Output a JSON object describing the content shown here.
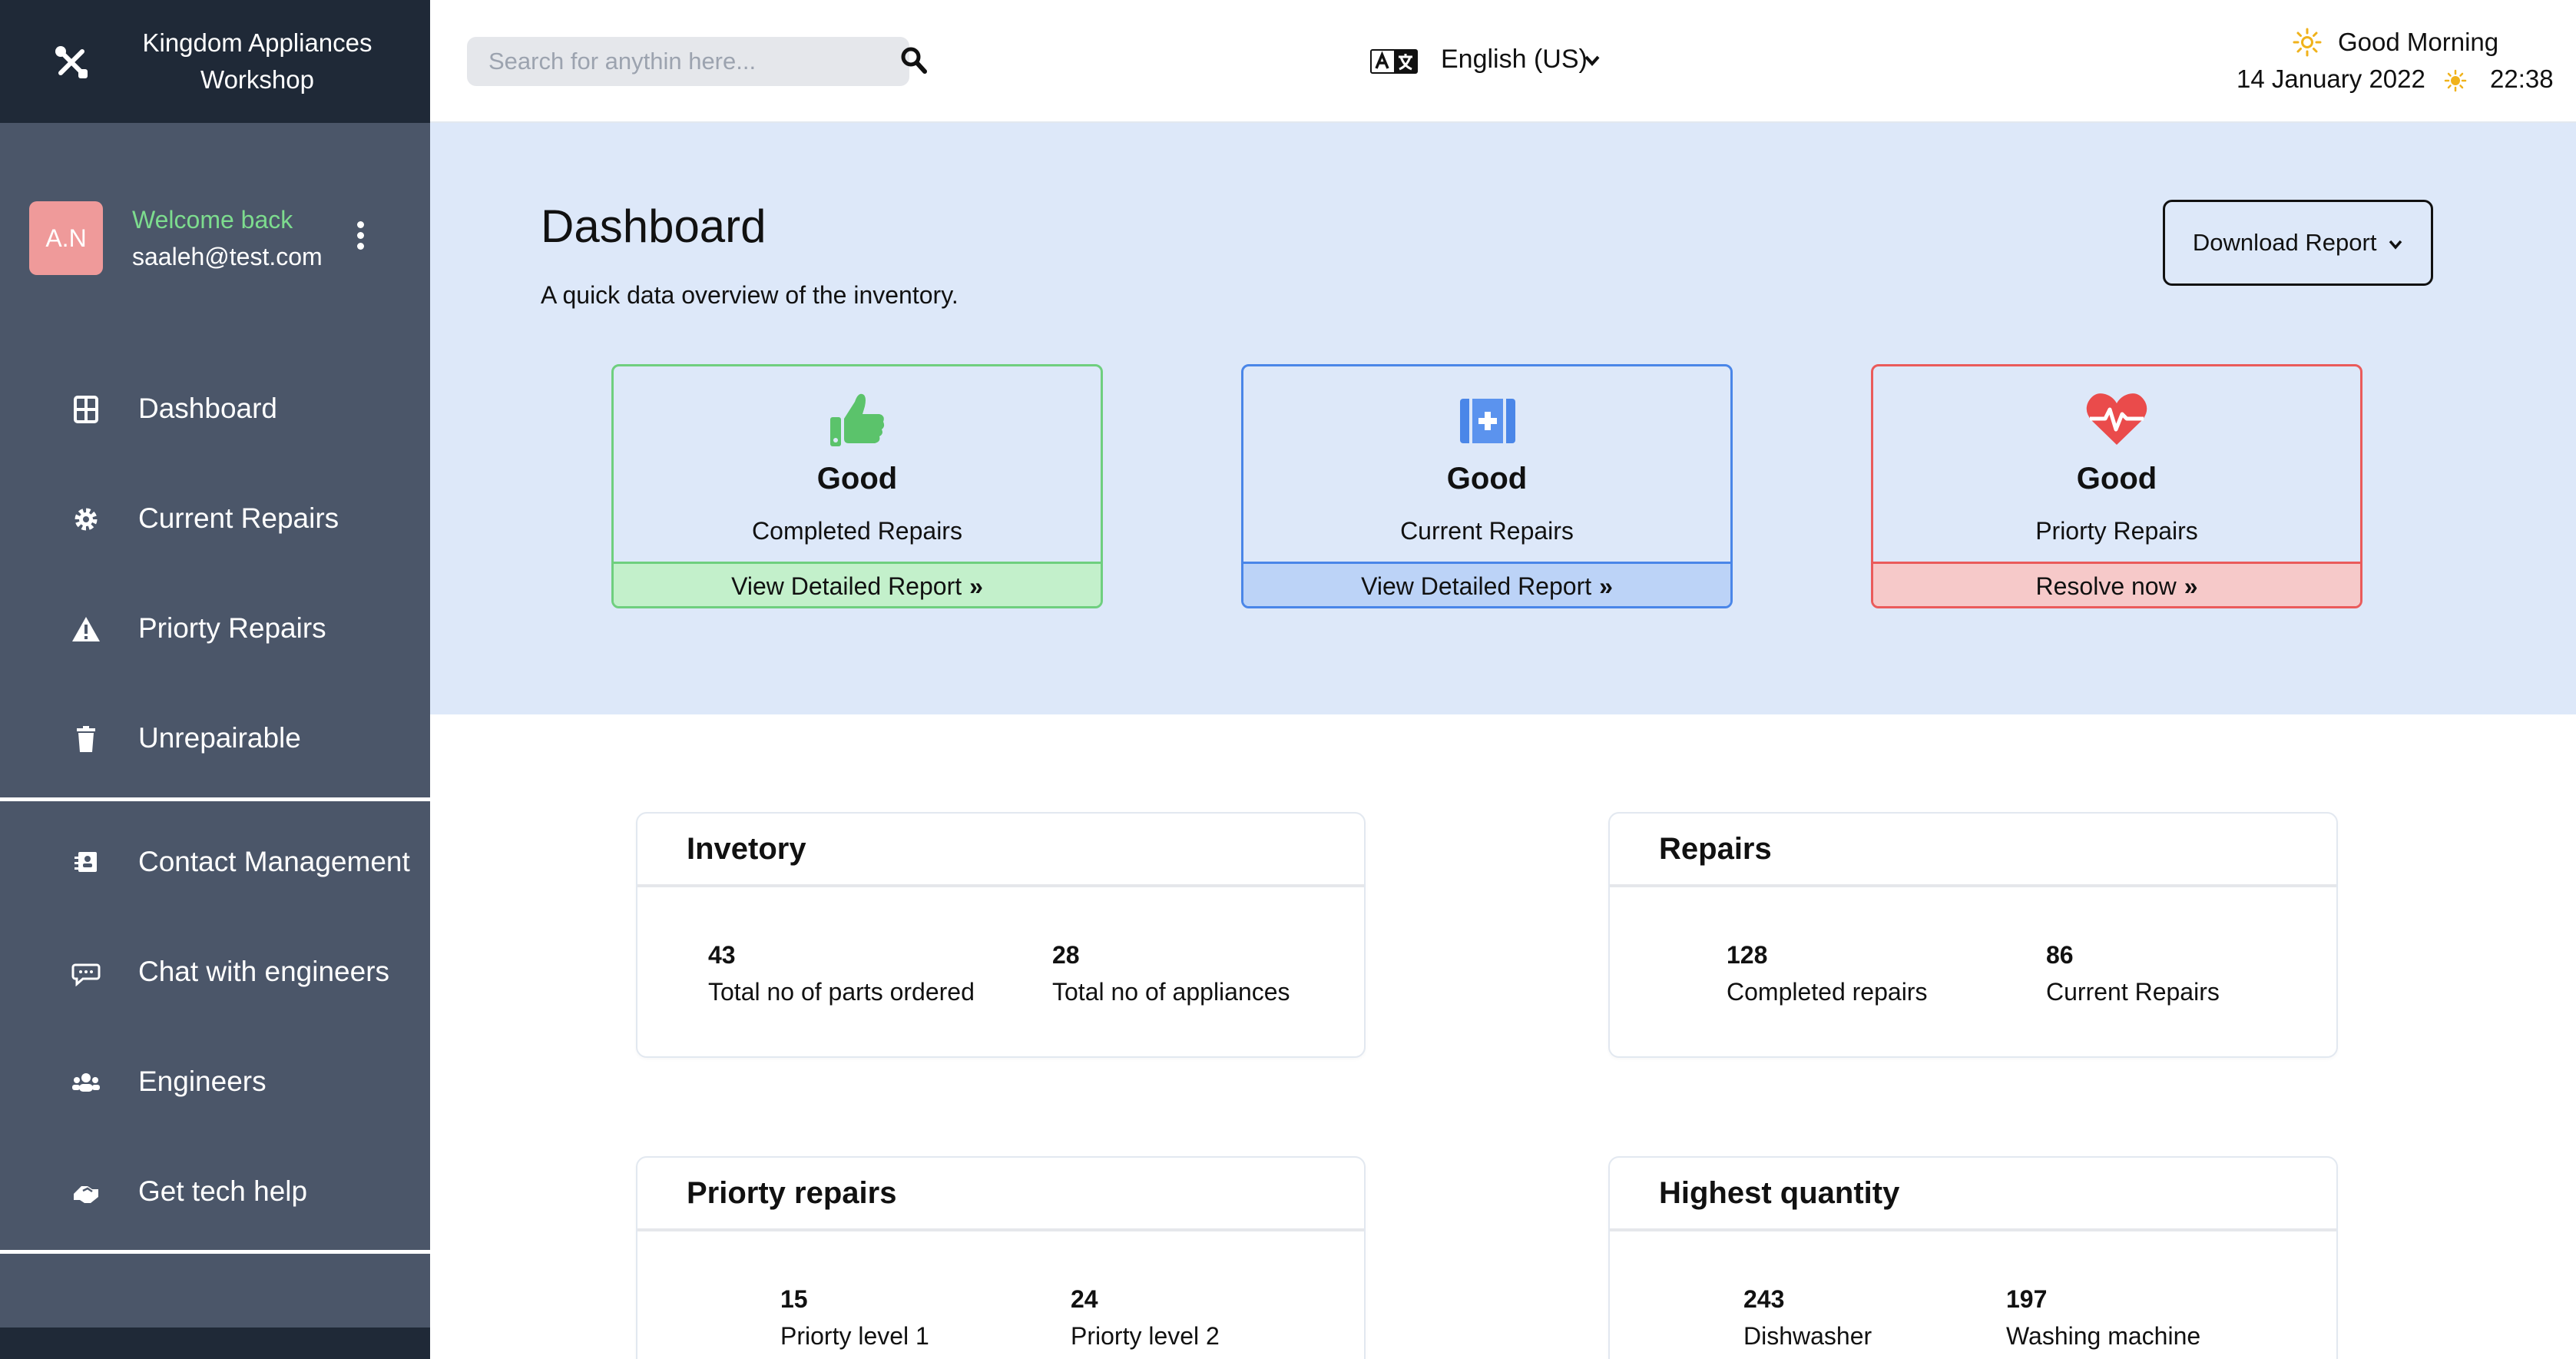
{
  "brand": {
    "title_line1": "Kingdom Appliances",
    "title_line2": "Workshop",
    "icon": "tools-icon"
  },
  "user": {
    "initials": "A.N",
    "welcome": "Welcome back",
    "email": "saaleh@test.com"
  },
  "sidebar": {
    "items": [
      {
        "label": "Dashboard",
        "icon": "grid-icon"
      },
      {
        "label": "Current Repairs",
        "icon": "gear-icon"
      },
      {
        "label": "Priorty Repairs",
        "icon": "warning-icon"
      },
      {
        "label": "Unrepairable",
        "icon": "trash-icon"
      },
      {
        "label": "Contact Management",
        "icon": "contacts-icon"
      },
      {
        "label": "Chat with engineers",
        "icon": "chat-icon"
      },
      {
        "label": "Engineers",
        "icon": "users-icon"
      },
      {
        "label": "Get tech help",
        "icon": "handshake-icon"
      }
    ]
  },
  "search": {
    "placeholder": "Search for anythin here..."
  },
  "language": {
    "label": "English (US)"
  },
  "greeting": {
    "text": "Good Morning",
    "date": "14 January 2022",
    "time": "22:38"
  },
  "dashboard": {
    "title": "Dashboard",
    "subtitle": "A quick data overview of the inventory.",
    "download_label": "Download Report"
  },
  "cards": [
    {
      "status": "Good",
      "label": "Completed Repairs",
      "link": "View Detailed Report",
      "icon": "thumbs-up-icon",
      "color": "#5bc36b"
    },
    {
      "status": "Good",
      "label": "Current Repairs",
      "link": "View Detailed Report",
      "icon": "medkit-icon",
      "color": "#4a86e8"
    },
    {
      "status": "Good",
      "label": "Priorty Repairs",
      "link": "Resolve now",
      "icon": "heartbeat-icon",
      "color": "#ea4b4b"
    }
  ],
  "panels": [
    {
      "title": "Invetory",
      "stats": [
        {
          "value": "43",
          "label": "Total no of parts ordered"
        },
        {
          "value": "28",
          "label": "Total no of appliances"
        }
      ]
    },
    {
      "title": "Repairs",
      "stats": [
        {
          "value": "128",
          "label": "Completed repairs"
        },
        {
          "value": "86",
          "label": "Current Repairs"
        }
      ]
    },
    {
      "title": "Priorty repairs",
      "stats": [
        {
          "value": "15",
          "label": "Priorty level 1"
        },
        {
          "value": "24",
          "label": "Priorty level 2"
        }
      ]
    },
    {
      "title": "Highest quantity",
      "stats": [
        {
          "value": "243",
          "label": "Dishwasher"
        },
        {
          "value": "197",
          "label": "Washing machine"
        }
      ]
    }
  ]
}
